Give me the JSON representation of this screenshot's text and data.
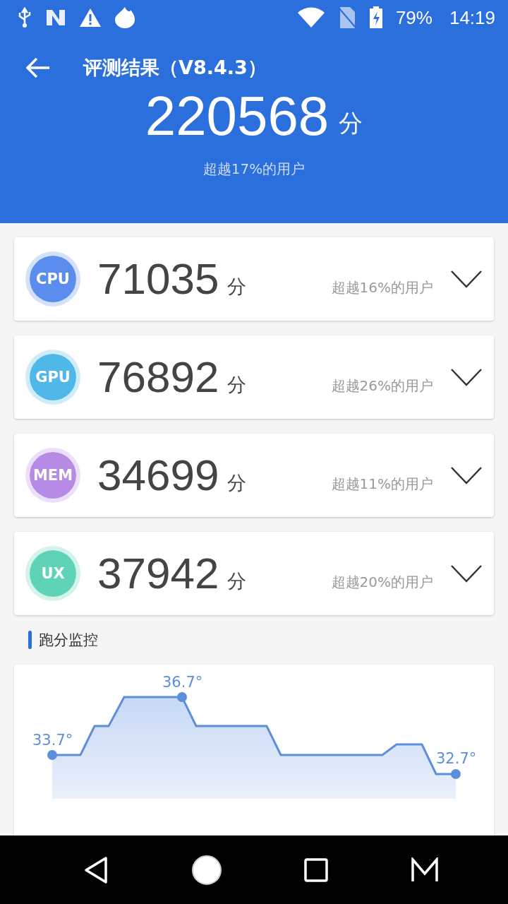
{
  "status_bar": {
    "battery": "79%",
    "time": "14:19"
  },
  "toolbar": {
    "title": "评测结果（V8.4.3）"
  },
  "total": {
    "score": "220568",
    "unit": "分",
    "rank": "超越17%的用户"
  },
  "categories": [
    {
      "label": "CPU",
      "score": "71035",
      "unit": "分",
      "rank": "超越16%的用户",
      "color": "#5b8def",
      "expanded": false
    },
    {
      "label": "GPU",
      "score": "76892",
      "unit": "分",
      "rank": "超越26%的用户",
      "color": "#4fb8e8",
      "expanded": false
    },
    {
      "label": "MEM",
      "score": "34699",
      "unit": "分",
      "rank": "超越11%的用户",
      "color": "#b58be6",
      "expanded": false
    },
    {
      "label": "UX",
      "score": "37942",
      "unit": "分",
      "rank": "超越20%的用户",
      "color": "#5fd3b5",
      "expanded": false
    }
  ],
  "monitor": {
    "title": "跑分监控",
    "start_label": "33.7°",
    "peak_label": "36.7°",
    "end_label": "32.7°"
  }
}
